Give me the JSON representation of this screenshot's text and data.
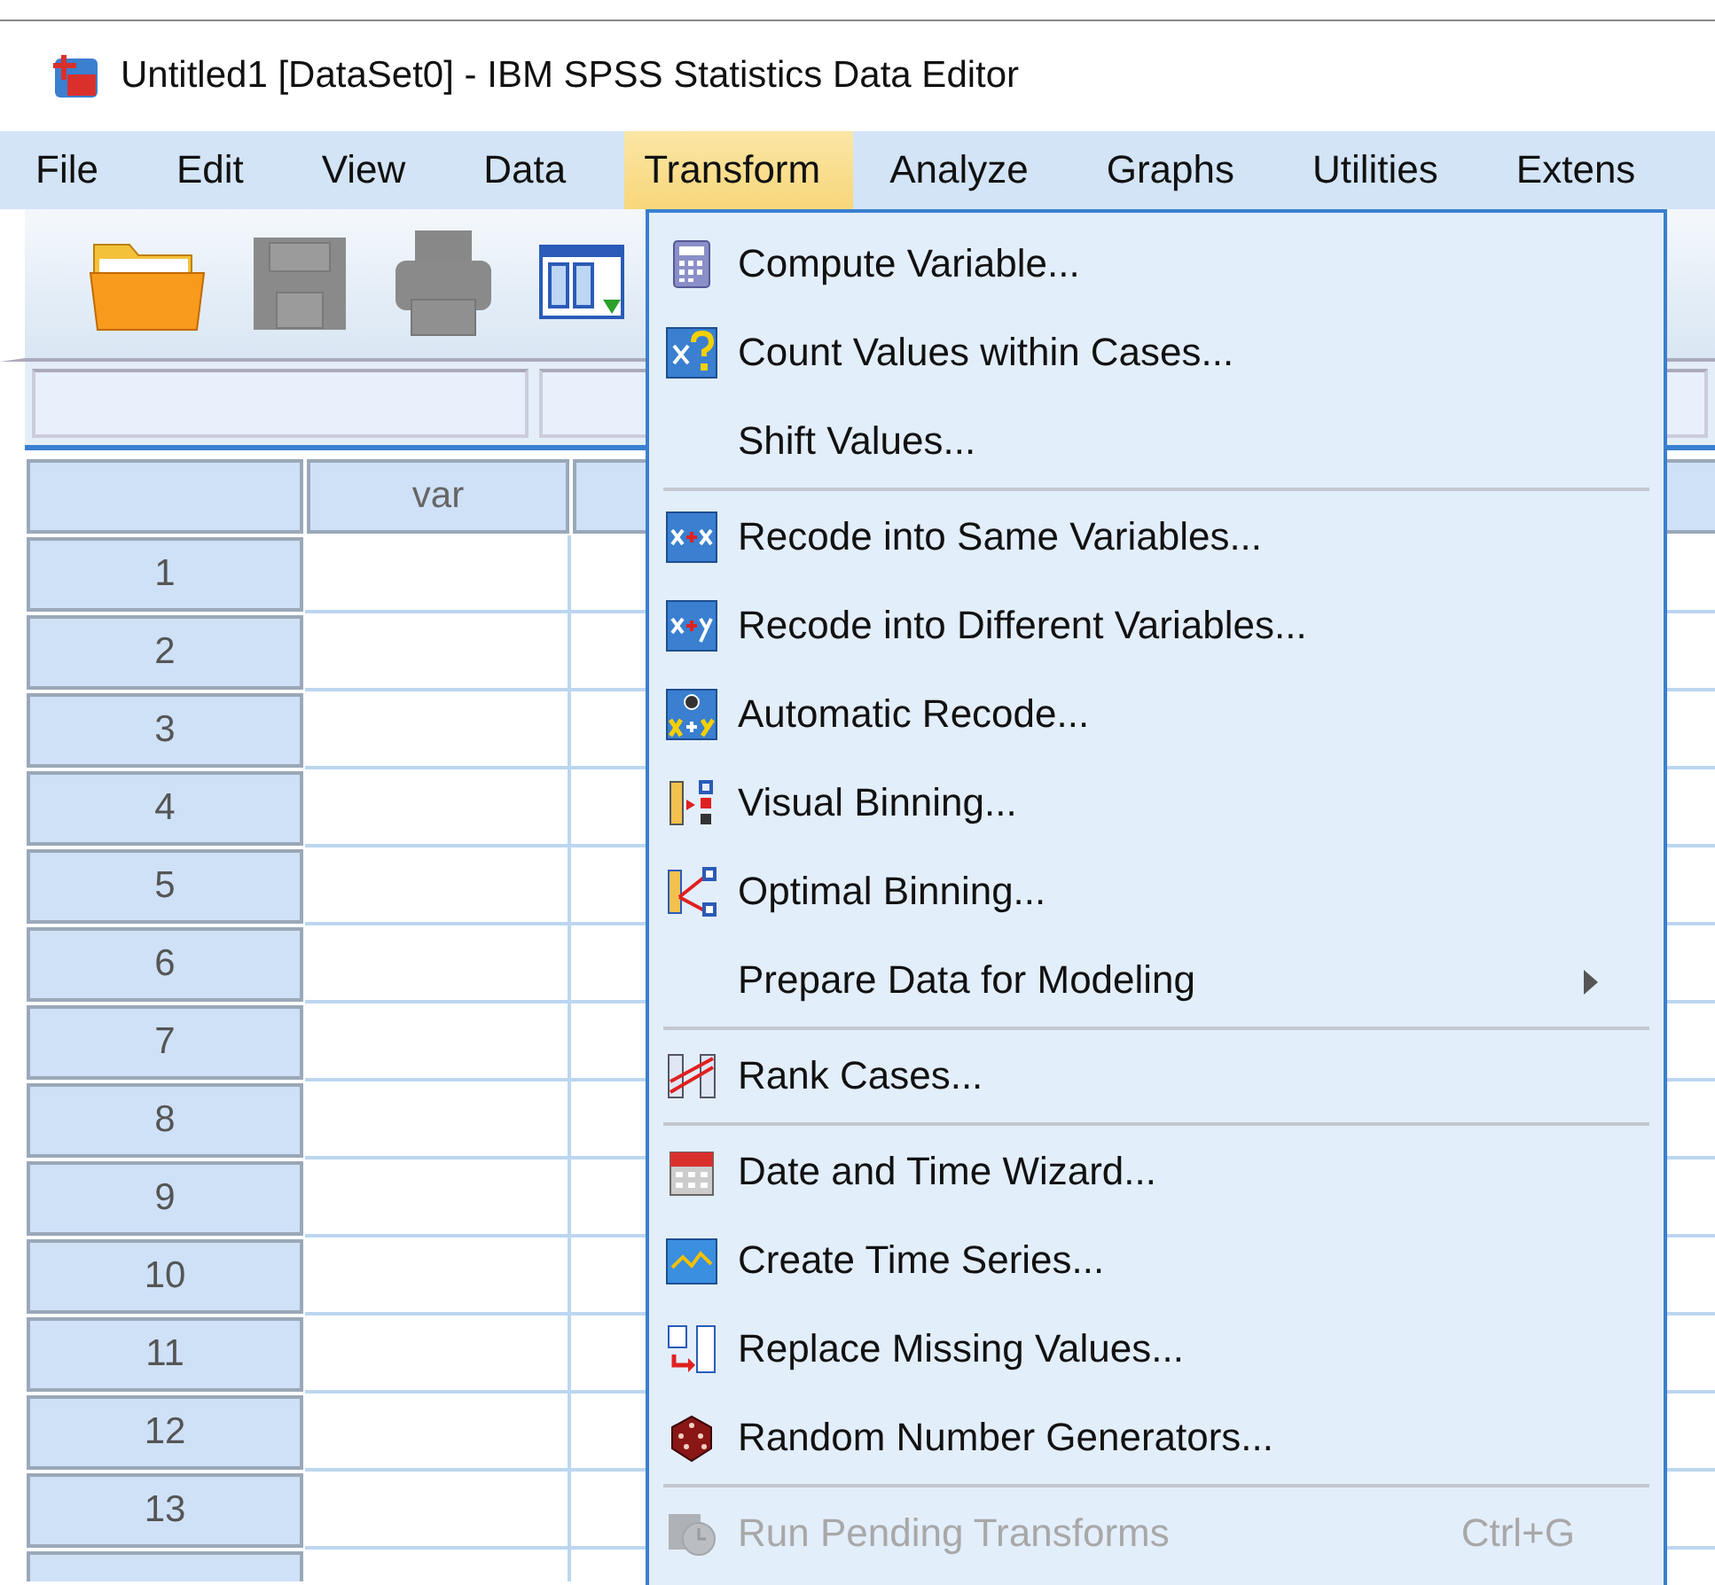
{
  "window": {
    "title": "Untitled1 [DataSet0] - IBM SPSS Statistics Data Editor"
  },
  "menu_bar": [
    {
      "label": "File",
      "selected": false
    },
    {
      "label": "Edit",
      "selected": false
    },
    {
      "label": "View",
      "selected": false
    },
    {
      "label": "Data",
      "selected": false
    },
    {
      "label": "Transform",
      "selected": true
    },
    {
      "label": "Analyze",
      "selected": false
    },
    {
      "label": "Graphs",
      "selected": false
    },
    {
      "label": "Utilities",
      "selected": false
    },
    {
      "label": "Extens",
      "selected": false
    }
  ],
  "grid": {
    "columns": [
      "var"
    ],
    "rows": [
      "1",
      "2",
      "3",
      "4",
      "5",
      "6",
      "7",
      "8",
      "9",
      "10",
      "11",
      "12",
      "13"
    ]
  },
  "transform_menu": {
    "items": [
      {
        "kind": "item",
        "label": "Compute Variable...",
        "disabled": false,
        "submenu": false
      },
      {
        "kind": "item",
        "label": "Count Values within Cases...",
        "disabled": false,
        "submenu": false
      },
      {
        "kind": "item",
        "label": "Shift Values...",
        "disabled": false,
        "submenu": false
      },
      {
        "kind": "separator"
      },
      {
        "kind": "item",
        "label": "Recode into Same Variables...",
        "disabled": false,
        "submenu": false
      },
      {
        "kind": "item",
        "label": "Recode into Different Variables...",
        "disabled": false,
        "submenu": false
      },
      {
        "kind": "item",
        "label": "Automatic Recode...",
        "disabled": false,
        "submenu": false
      },
      {
        "kind": "item",
        "label": "Visual Binning...",
        "disabled": false,
        "submenu": false
      },
      {
        "kind": "item",
        "label": "Optimal Binning...",
        "disabled": false,
        "submenu": false
      },
      {
        "kind": "item",
        "label": "Prepare Data for Modeling",
        "disabled": false,
        "submenu": true
      },
      {
        "kind": "separator"
      },
      {
        "kind": "item",
        "label": "Rank Cases...",
        "disabled": false,
        "submenu": false
      },
      {
        "kind": "separator"
      },
      {
        "kind": "item",
        "label": "Date and Time Wizard...",
        "disabled": false,
        "submenu": false
      },
      {
        "kind": "item",
        "label": "Create Time Series...",
        "disabled": false,
        "submenu": false
      },
      {
        "kind": "item",
        "label": "Replace Missing Values...",
        "disabled": false,
        "submenu": false
      },
      {
        "kind": "item",
        "label": "Random Number Generators...",
        "disabled": false,
        "submenu": false
      },
      {
        "kind": "separator"
      },
      {
        "kind": "item",
        "label": "Run Pending Transforms",
        "shortcut": "Ctrl+G",
        "disabled": true,
        "submenu": false
      }
    ]
  }
}
